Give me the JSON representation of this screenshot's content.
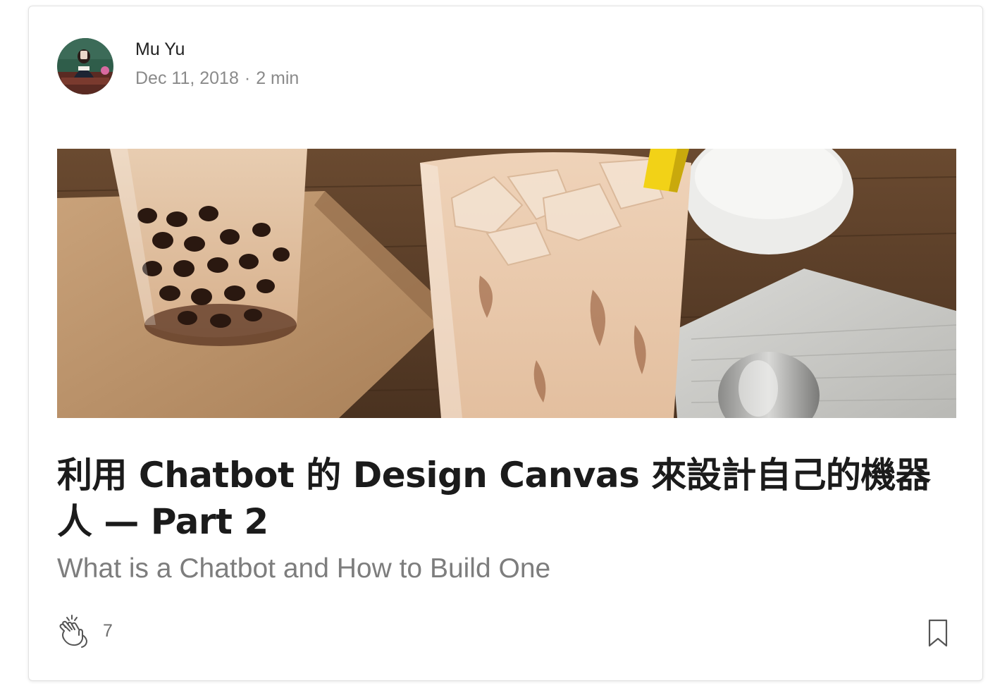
{
  "post": {
    "author_name": "Mu Yu",
    "date": "Dec 11, 2018",
    "read_time": "2 min",
    "title": "利用 Chatbot 的 Design Canvas 來設計自己的機器人 — Part 2",
    "subtitle": "What is a Chatbot and How to Build One",
    "clap_count": "7"
  },
  "icons": {
    "clap": "clap-icon",
    "bookmark": "bookmark-icon",
    "avatar": "avatar"
  },
  "colors": {
    "title": "#1b1b1b",
    "meta": "#8a8a8a",
    "subtitle": "#7d7d7d",
    "card_border": "#e2e2e2"
  }
}
